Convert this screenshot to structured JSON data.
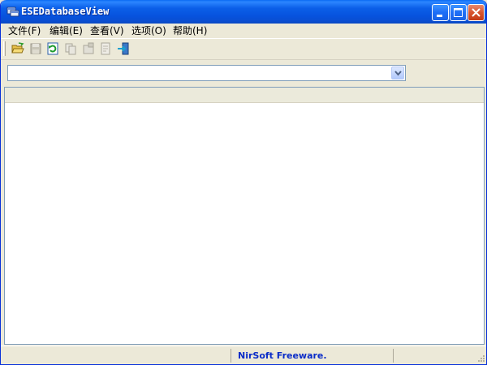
{
  "window": {
    "title": "ESEDatabaseView"
  },
  "titlebar_buttons": [
    {
      "name": "minimize-button",
      "icon": "minimize-icon"
    },
    {
      "name": "maximize-button",
      "icon": "maximize-icon"
    },
    {
      "name": "close-button",
      "icon": "close-icon"
    }
  ],
  "menu": {
    "items": [
      {
        "label": "文件(F)"
      },
      {
        "label": "编辑(E)"
      },
      {
        "label": "查看(V)"
      },
      {
        "label": "选项(O)"
      },
      {
        "label": "帮助(H)"
      }
    ]
  },
  "toolbar": {
    "tools": [
      {
        "icon": "open-folder-icon",
        "enabled": true
      },
      {
        "icon": "save-icon",
        "enabled": false
      },
      {
        "icon": "refresh-icon",
        "enabled": true
      },
      {
        "icon": "copy-icon",
        "enabled": false
      },
      {
        "icon": "properties-icon",
        "enabled": false
      },
      {
        "icon": "html-report-icon",
        "enabled": false
      },
      {
        "icon": "exit-icon",
        "enabled": true
      }
    ]
  },
  "table_selector": {
    "value": "",
    "icon": "chevron-down-icon"
  },
  "list": {
    "columns": [],
    "rows": []
  },
  "status": {
    "left": "",
    "center": "NirSoft Freeware.",
    "right": ""
  },
  "colors": {
    "titlebar": "#0752dd",
    "status_text": "#0a2cc8",
    "face": "#ece9d8"
  }
}
